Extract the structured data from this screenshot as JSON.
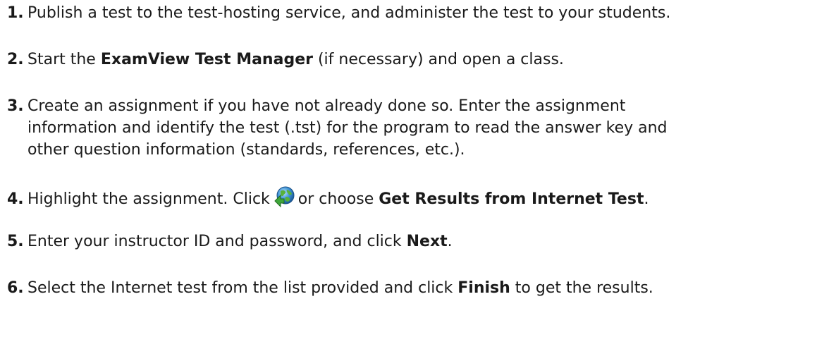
{
  "steps": [
    {
      "number": "1.",
      "text": "Publish a test to the test-hosting service, and administer the test to your students."
    },
    {
      "number": "2.",
      "pre": "Start the ",
      "bold": "ExamView Test Manager",
      "post": " (if necessary) and open a class."
    },
    {
      "number": "3.",
      "line1": "Create an assignment if you have not already done so.  Enter the assignment",
      "line2": "information and identify the test (.tst) for the program to read the answer key and",
      "line3": "other question information (standards, references, etc.)."
    },
    {
      "number": "4.",
      "pre": "Highlight the assignment. Click",
      "icon": "get-internet-results-globe-icon",
      "mid": "or choose ",
      "bold": "Get Results from Internet Test",
      "post": "."
    },
    {
      "number": "5.",
      "pre": "Enter your instructor ID and password, and click ",
      "bold": "Next",
      "post": "."
    },
    {
      "number": "6.",
      "pre": "Select the Internet test from the list provided and click ",
      "bold": "Finish",
      "post": " to get the results."
    }
  ]
}
